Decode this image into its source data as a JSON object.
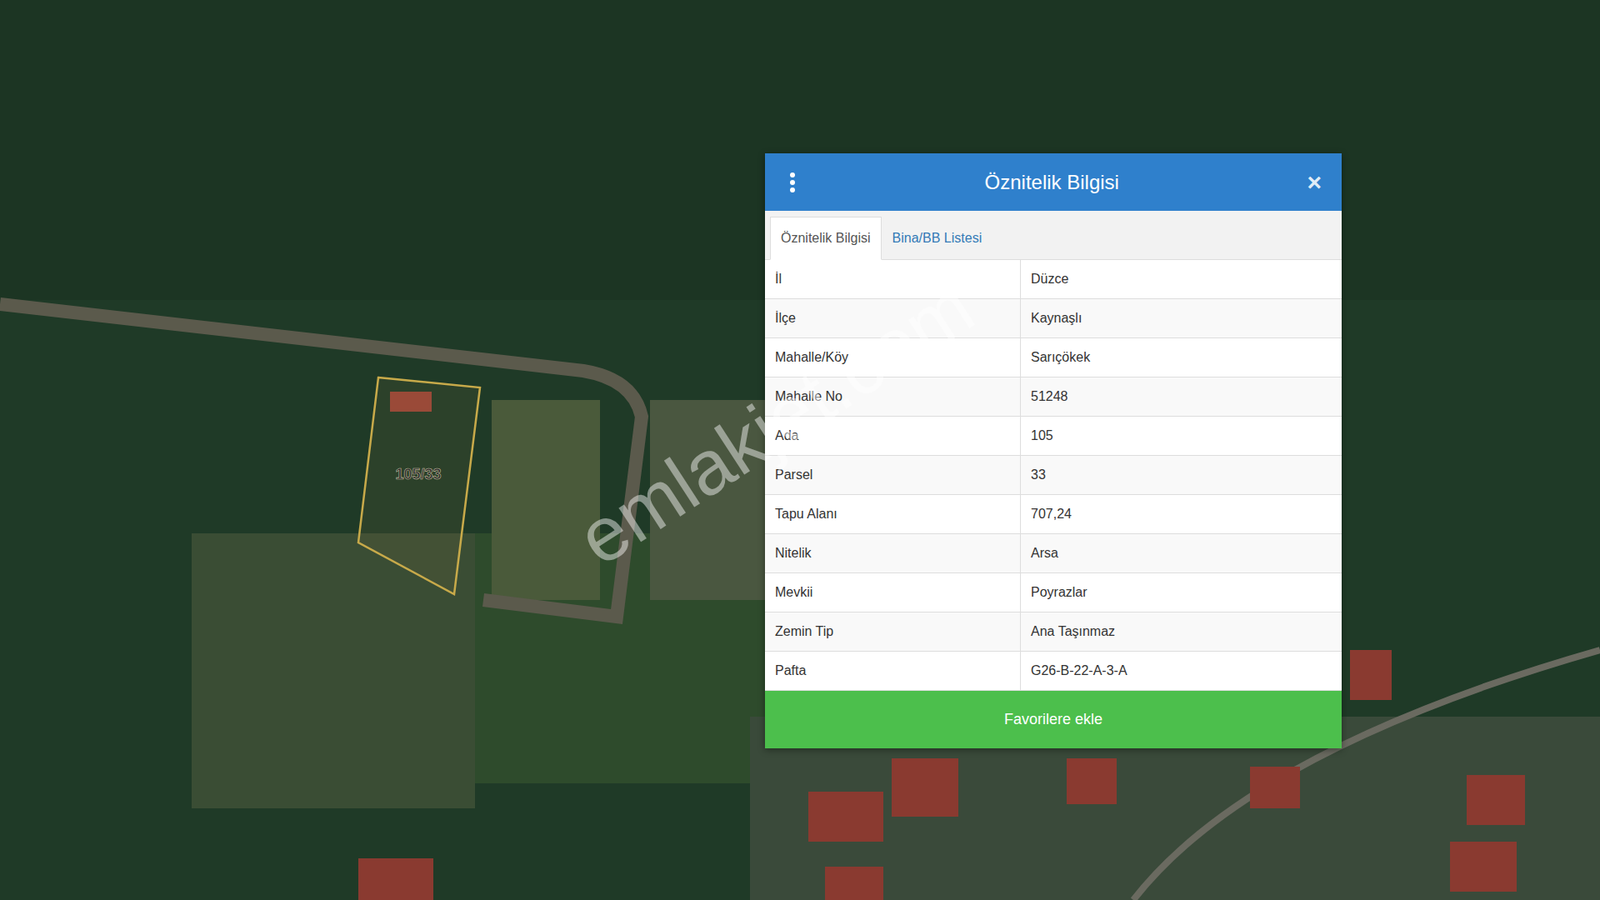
{
  "map": {
    "parcel_label": "105/33",
    "watermark": "emlakjet.com"
  },
  "popup": {
    "title": "Öznitelik Bilgisi",
    "close": "×",
    "tabs": [
      {
        "label": "Öznitelik Bilgisi",
        "selected": true
      },
      {
        "label": "Bina/BB Listesi",
        "selected": false
      }
    ],
    "rows": [
      {
        "label": "İl",
        "value": "Düzce"
      },
      {
        "label": "İlçe",
        "value": "Kaynaşlı"
      },
      {
        "label": "Mahalle/Köy",
        "value": "Sarıçökek"
      },
      {
        "label": "Mahalle No",
        "value": "51248"
      },
      {
        "label": "Ada",
        "value": "105"
      },
      {
        "label": "Parsel",
        "value": "33"
      },
      {
        "label": "Tapu Alanı",
        "value": "707,24"
      },
      {
        "label": "Nitelik",
        "value": "Arsa"
      },
      {
        "label": "Mevkii",
        "value": "Poyrazlar"
      },
      {
        "label": "Zemin Tip",
        "value": "Ana Taşınmaz"
      },
      {
        "label": "Pafta",
        "value": "G26-B-22-A-3-A"
      }
    ],
    "button": "Favorilere ekle"
  }
}
